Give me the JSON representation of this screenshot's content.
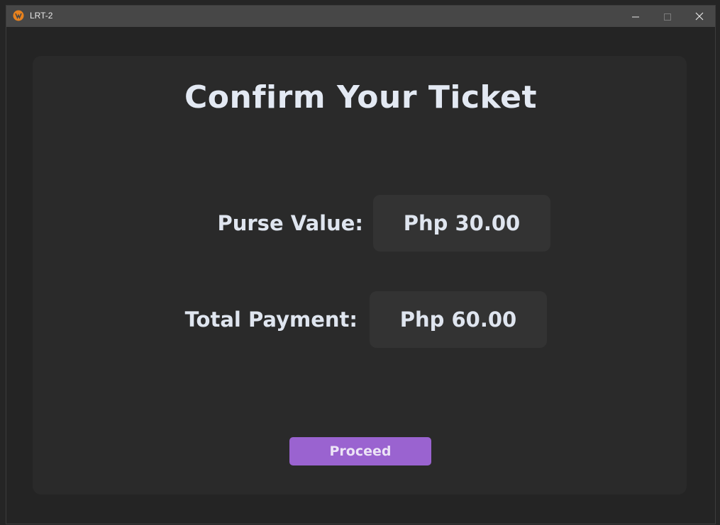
{
  "window": {
    "title": "LRT-2"
  },
  "heading": "Confirm Your Ticket",
  "purse": {
    "label": "Purse Value:",
    "value": "Php 30.00"
  },
  "total": {
    "label": "Total Payment:",
    "value": "Php 60.00"
  },
  "actions": {
    "proceed_label": "Proceed"
  },
  "icons": {
    "app": "app-logo-icon",
    "minimize": "minimize-icon",
    "maximize": "maximize-icon",
    "close": "close-icon"
  },
  "colors": {
    "accent": "#9a63d0",
    "card": "#2a2a2a",
    "value_box": "#333333",
    "titlebar": "#474747",
    "text": "#dfe5ef",
    "logo": "#e8821e"
  }
}
